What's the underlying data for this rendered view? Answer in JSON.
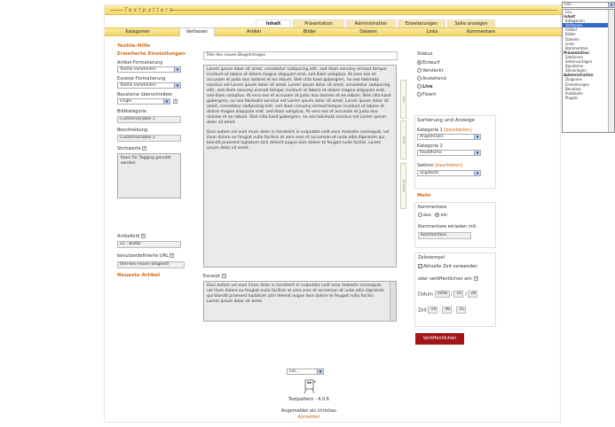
{
  "brand": {
    "logo": "Textpattern",
    "version": "Textpattern · 4.0.6",
    "logged_in": "Angemeldet als christian",
    "logout": "Abmelden"
  },
  "primary_tabs": [
    {
      "label": "Inhalt",
      "active": true
    },
    {
      "label": "Präsentation",
      "active": false
    },
    {
      "label": "Administration",
      "active": false
    },
    {
      "label": "Erweiterungen",
      "active": false
    },
    {
      "label": "Seite anzeigen",
      "active": false
    }
  ],
  "secondary_tabs": [
    {
      "label": "Kategorien",
      "active": false
    },
    {
      "label": "Verfassen",
      "active": true
    },
    {
      "label": "Artikel",
      "active": false
    },
    {
      "label": "Bilder",
      "active": false
    },
    {
      "label": "Dateien",
      "active": false
    },
    {
      "label": "Links",
      "active": false
    },
    {
      "label": "Kommentare",
      "active": false
    }
  ],
  "left": {
    "help": "Textile-Hilfe",
    "advanced": "Erweiterte Einstellungen",
    "article_markup_label": "Artikel-Formatierung",
    "article_markup": "Textile verwenden",
    "excerpt_markup_label": "Exzerpt-Formatierung",
    "excerpt_markup": "Textile verwenden",
    "override_label": "Bausteine überschreiben",
    "override": "single",
    "img_cat_label": "Bildkategorie",
    "img_cat": "Customvariable 1",
    "desc_label": "Beschreibung",
    "desc": "Customvariable 2",
    "keywords_label": "Stichworte",
    "keywords": "Kann für Tagging genutzt werden",
    "article_image_label": "Artikelbild",
    "article_image": "21 - BildID",
    "url_title_label": "benutzerdefinierte URL",
    "url_title": "titel-des-neuen-blogeintr",
    "recent": "Neueste Artikel"
  },
  "main": {
    "title": "Titel des neuen Blogeintrages",
    "body_p1": "Lorem ipsum dolor sit amet, consetetur sadipscing elitr, sed diam nonumy eirmod tempor invidunt ut labore et dolore magna aliquyam erat, sed diam voluptua. At vero eos et accusam et justo duo dolores et ea rebum. Stet clita kasd gubergren, no sea takimata sanctus est Lorem ipsum dolor sit amet. Lorem ipsum dolor sit amet, consetetur sadipscing elitr, sed diam nonumy eirmod tempor invidunt ut labore et dolore magna aliquyam erat, sed diam voluptua. At vero eos et accusam et justo duo dolores et ea rebum. Stet clita kasd gubergren, no sea takimata sanctus est Lorem ipsum dolor sit amet. Lorem ipsum dolor sit amet, consetetur sadipscing elitr, sed diam nonumy eirmod tempor invidunt ut labore et dolore magna aliquyam erat, sed diam voluptua. At vero eos et accusam et justo duo dolores et ea rebum. Stet clita kasd gubergren, no sea takimata sanctus est Lorem ipsum dolor sit amet.",
    "body_p2": "Duis autem vel eum iriure dolor in hendrerit in vulputate velit esse molestie consequat, vel illum dolore eu feugiat nulla facilisis at vero eros et accumsan et iusto odio dignissim qui blandit praesent luptatum zzril delenit augue duis dolore te feugait nulla facilisi. Lorem ipsum dolor sit amet.",
    "excerpt_label": "Excerpt",
    "excerpt": "Duis autem vel eum iriure dolor in hendrerit in vulputate velit esse molestie consequat, vel illum dolore eu feugiat nulla facilisis at vero eros et accumsan et iusto odio dignissim qui blandit praesent luptatum zzril delenit augue duis dolore te feugait nulla facilisi. Lorem ipsum dolor sit amet.",
    "vtabs": [
      "text",
      "html",
      "preview"
    ]
  },
  "right": {
    "status_label": "Status",
    "status_options": [
      {
        "label": "Entwurf",
        "selected": true,
        "bold": false
      },
      {
        "label": "Versteckt",
        "selected": false,
        "bold": false
      },
      {
        "label": "Anstehend",
        "selected": false,
        "bold": false
      },
      {
        "label": "Live",
        "selected": false,
        "bold": true
      },
      {
        "label": "Fixiert",
        "selected": false,
        "bold": false
      }
    ],
    "sort_label": "Sortierung und Anzeige",
    "cat1_label": "Kategorie 1",
    "edit": "[bearbeiten]",
    "cat1": "Angelreisen",
    "cat2_label": "Kategorie 2",
    "cat2": "Raubfische",
    "section_label": "Sektion",
    "section": "angebote",
    "more": "Mehr",
    "comments_label": "Kommentare",
    "comments_off": "aus",
    "comments_on": "ein",
    "invite_label": "Kommentare einladen mit:",
    "invite": "Kommentare",
    "timestamp_label": "Zeitstempel",
    "use_current": "Aktuelle Zeit verwenden",
    "or_publish": "oder veröffentlichen am:",
    "date_label": "Datum",
    "year": "2008",
    "month": "10",
    "day": "28",
    "time_label": "Zeit",
    "hour": "19",
    "minute": "46",
    "second": "35",
    "publish": "Veröffentlichen"
  },
  "footer": {
    "goto": "Los..."
  },
  "nav_dropdown": {
    "value": "Los...",
    "items": [
      {
        "label": "Los...",
        "type": "item"
      },
      {
        "label": "Inhalt",
        "type": "grp"
      },
      {
        "label": "Kategorien",
        "type": "item"
      },
      {
        "label": "Verfassen",
        "type": "hl"
      },
      {
        "label": "Artikel",
        "type": "item"
      },
      {
        "label": "Bilder",
        "type": "item"
      },
      {
        "label": "Dateien",
        "type": "item"
      },
      {
        "label": "Links",
        "type": "item"
      },
      {
        "label": "Kommentare",
        "type": "item"
      },
      {
        "label": "Präsentation",
        "type": "grp"
      },
      {
        "label": "Sektionen",
        "type": "item"
      },
      {
        "label": "Seitenvorlagen",
        "type": "item"
      },
      {
        "label": "Bausteine",
        "type": "item"
      },
      {
        "label": "Stilvorlagen",
        "type": "item"
      },
      {
        "label": "Administration",
        "type": "grp"
      },
      {
        "label": "Diagnose",
        "type": "item"
      },
      {
        "label": "Einstellungen",
        "type": "item"
      },
      {
        "label": "Benutzer",
        "type": "item"
      },
      {
        "label": "Protokolle",
        "type": "item"
      },
      {
        "label": "Plugins",
        "type": "item"
      }
    ]
  }
}
